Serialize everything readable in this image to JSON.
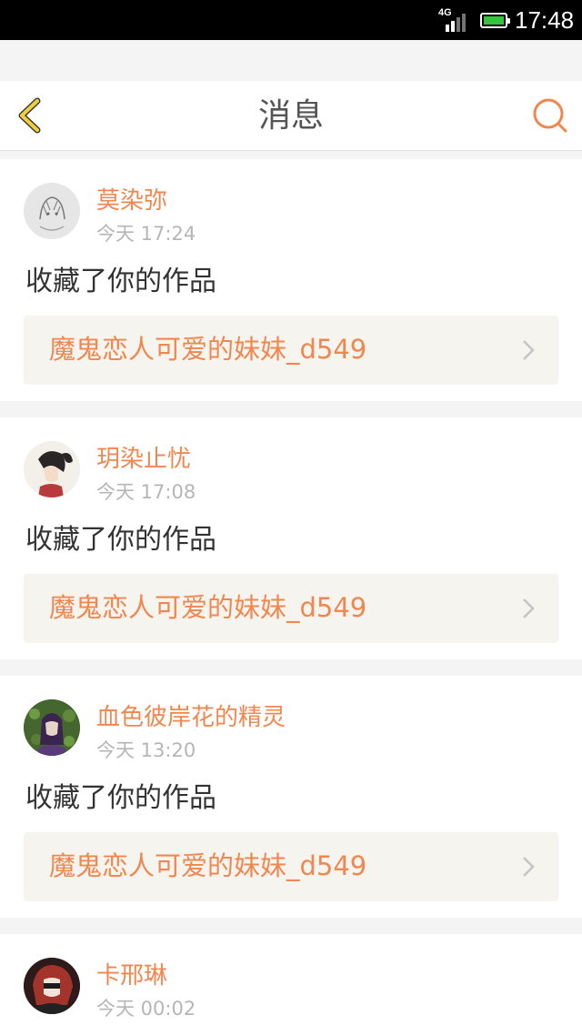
{
  "status_bar": {
    "network": "4G",
    "time": "17:48",
    "battery": 1.0
  },
  "header": {
    "title": "消息",
    "back_icon": "chevron-left-icon",
    "search_icon": "search-icon"
  },
  "colors": {
    "accent": "#f1874f",
    "back_icon": "#f0cf3a",
    "link_bg": "#f5f4ef"
  },
  "messages": [
    {
      "username": "莫染弥",
      "time": "今天 17:24",
      "action": "收藏了你的作品",
      "work_title": "魔鬼恋人可爱的妹妹_d549"
    },
    {
      "username": "玥染止忧",
      "time": "今天 17:08",
      "action": "收藏了你的作品",
      "work_title": "魔鬼恋人可爱的妹妹_d549"
    },
    {
      "username": "血色彼岸花的精灵",
      "time": "今天 13:20",
      "action": "收藏了你的作品",
      "work_title": "魔鬼恋人可爱的妹妹_d549"
    },
    {
      "username": "卡邢琳",
      "time": "今天 00:02"
    }
  ]
}
